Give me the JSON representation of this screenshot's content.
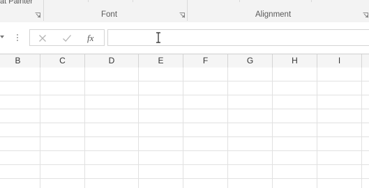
{
  "ribbon": {
    "clipboard_fragment": "at Painter",
    "groups": [
      {
        "label": "Font"
      },
      {
        "label": "Alignment"
      }
    ]
  },
  "formula_bar": {
    "cancel_icon": "cancel-x-icon",
    "enter_icon": "enter-check-icon",
    "function_label": "fx",
    "value": ""
  },
  "columns": [
    "B",
    "C",
    "D",
    "E",
    "F",
    "G",
    "H",
    "I"
  ]
}
